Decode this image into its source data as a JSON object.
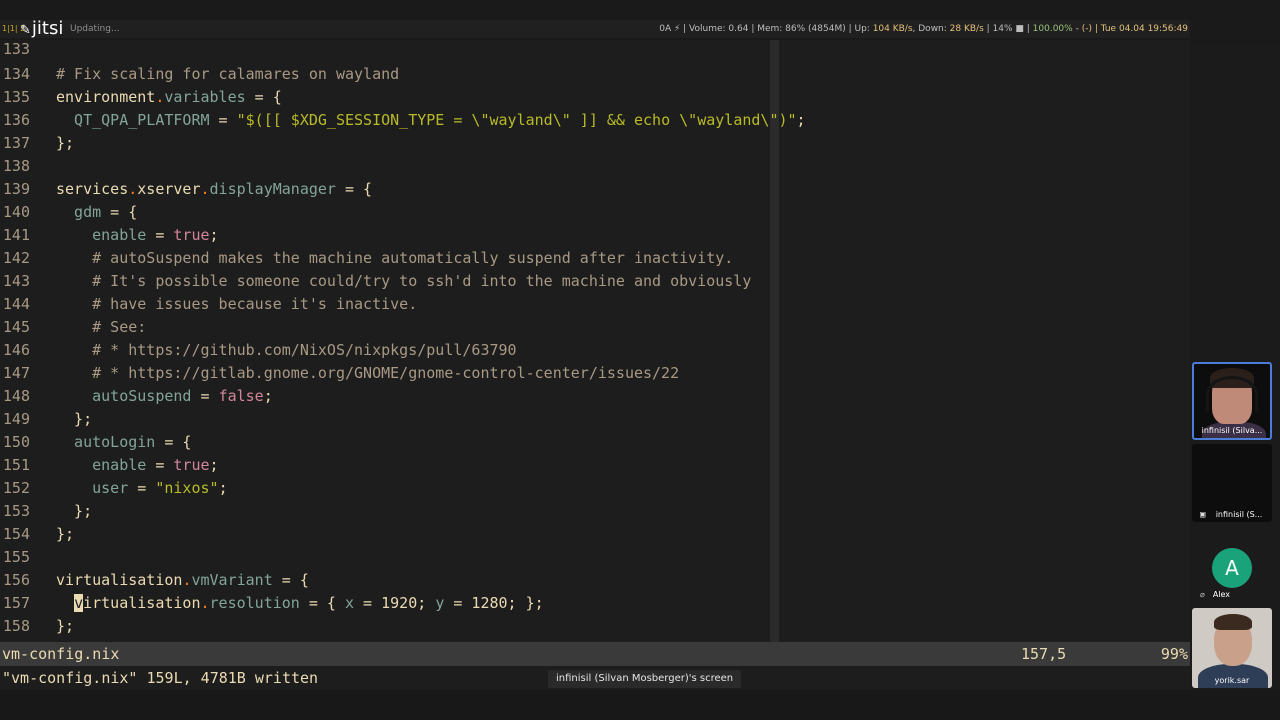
{
  "topbar": {
    "workspace": "1|1| 2",
    "app_logo": "jitsi",
    "updating": "Updating...",
    "sysinfo": {
      "prefix": "0A ⚡ | Volume: 0.64 | Mem: 86% (4854M) | Up: ",
      "up": "104 KB/s",
      "down_label": ", Down: ",
      "down": "28 KB/s",
      "cpu": " | 14% ■ | ",
      "battery": "100.00%",
      "battery_suffix": " - (-) | ",
      "datetime": "Tue 04.04 19:56:49"
    }
  },
  "editor": {
    "lines": [
      {
        "n": "133"
      },
      {
        "n": "134"
      },
      {
        "n": "135"
      },
      {
        "n": "136"
      },
      {
        "n": "137"
      },
      {
        "n": "138"
      },
      {
        "n": "139"
      },
      {
        "n": "140"
      },
      {
        "n": "141"
      },
      {
        "n": "142"
      },
      {
        "n": "143"
      },
      {
        "n": "144"
      },
      {
        "n": "145"
      },
      {
        "n": "146"
      },
      {
        "n": "147"
      },
      {
        "n": "148"
      },
      {
        "n": "149"
      },
      {
        "n": "150"
      },
      {
        "n": "151"
      },
      {
        "n": "152"
      },
      {
        "n": "153"
      },
      {
        "n": "154"
      },
      {
        "n": "155"
      },
      {
        "n": "156"
      },
      {
        "n": "157"
      },
      {
        "n": "158"
      }
    ],
    "code": {
      "l134": "# Fix scaling for calamares on wayland",
      "l135_a": "environment",
      "l135_b": ".",
      "l135_c": "variables",
      "l135_d": " = {",
      "l136_a": "  QT_QPA_PLATFORM",
      "l136_b": " = ",
      "l136_c": "\"$([[ $XDG_SESSION_TYPE = \\\"wayland\\\" ]] && echo \\\"wayland\\\")\"",
      "l136_d": ";",
      "l137": "};",
      "l139_a": "services",
      "l139_b": ".",
      "l139_c": "xserver",
      "l139_d": ".",
      "l139_e": "displayManager",
      "l139_f": " = {",
      "l140_a": "  gdm",
      "l140_b": " = {",
      "l141_a": "    enable",
      "l141_b": " = ",
      "l141_c": "true",
      "l141_d": ";",
      "l142": "    # autoSuspend makes the machine automatically suspend after inactivity.",
      "l143": "    # It's possible someone could/try to ssh'd into the machine and obviously",
      "l144": "    # have issues because it's inactive.",
      "l145": "    # See:",
      "l146": "    # * https://github.com/NixOS/nixpkgs/pull/63790",
      "l147": "    # * https://gitlab.gnome.org/GNOME/gnome-control-center/issues/22",
      "l148_a": "    autoSuspend",
      "l148_b": " = ",
      "l148_c": "false",
      "l148_d": ";",
      "l149": "  };",
      "l150_a": "  autoLogin",
      "l150_b": " = {",
      "l151_a": "    enable",
      "l151_b": " = ",
      "l151_c": "true",
      "l151_d": ";",
      "l152_a": "    user",
      "l152_b": " = ",
      "l152_c": "\"nixos\"",
      "l152_d": ";",
      "l153": "  };",
      "l154": "};",
      "l156_a": "virtualisation",
      "l156_b": ".",
      "l156_c": "vmVariant",
      "l156_d": " = {",
      "l157_pre": "  ",
      "l157_cursor": "v",
      "l157_a": "irtualisation",
      "l157_b": ".",
      "l157_c": "resolution",
      "l157_d": " = { ",
      "l157_e": "x",
      "l157_f": " = 1920; ",
      "l157_g": "y",
      "l157_h": " = 1280; };",
      "l158": "};"
    }
  },
  "modeline": {
    "filename": "vm-config.nix",
    "position": "157,5",
    "percent": "99%"
  },
  "cmdline": {
    "message": "\"vm-config.nix\" 159L, 4781B written"
  },
  "share_label": "infinisil (Silvan Mosberger)'s screen",
  "participants": {
    "p1": "infinisil (Silva...",
    "p2": "infinisil (S...",
    "p3_initial": "A",
    "p3": "Alex",
    "p4": "yorik.sar"
  }
}
